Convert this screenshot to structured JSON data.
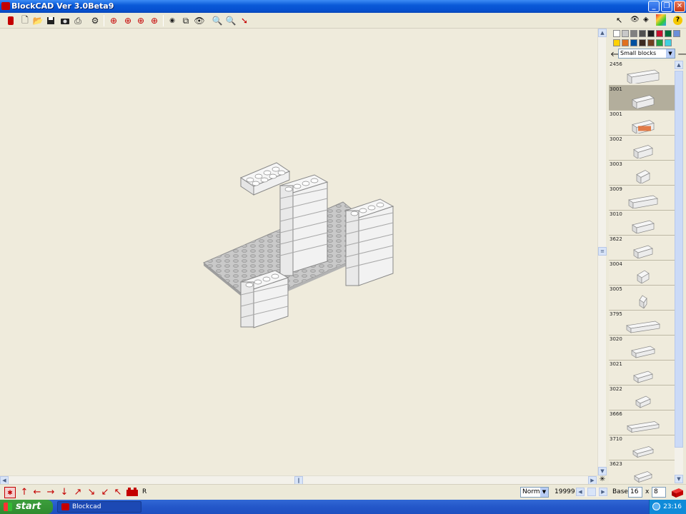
{
  "window": {
    "title": "BlockCAD Ver 3.0Beta9"
  },
  "toolbar": {
    "icons": [
      "brick-icon",
      "new-icon",
      "open-icon",
      "save-icon",
      "camera-icon",
      "print-icon",
      "settings-icon",
      "rotate-left-icon",
      "rotate-up-icon",
      "rotate-down-icon",
      "rotate-right-icon",
      "rotate-icon",
      "copy-view-icon",
      "view-icon",
      "zoom-in-icon",
      "zoom-out-icon",
      "pen-icon"
    ]
  },
  "palette": {
    "colors": [
      "#ffffff",
      "#c8c8c8",
      "#808080",
      "#505050",
      "#202020",
      "#c8102e",
      "#006f3c",
      "#6b8fd8",
      "#ffd100",
      "#e07020",
      "#0050a0",
      "#3c2a20",
      "#704020",
      "#20a040",
      "#40d0e0"
    ],
    "category_selected": "Small blocks"
  },
  "blocks": [
    {
      "id": "2456"
    },
    {
      "id": "3001"
    },
    {
      "id": "3001"
    },
    {
      "id": "3002"
    },
    {
      "id": "3003"
    },
    {
      "id": "3009"
    },
    {
      "id": "3010"
    },
    {
      "id": "3622"
    },
    {
      "id": "3004"
    },
    {
      "id": "3005"
    },
    {
      "id": "3795"
    },
    {
      "id": "3020"
    },
    {
      "id": "3021"
    },
    {
      "id": "3022"
    },
    {
      "id": "3666"
    },
    {
      "id": "3710"
    },
    {
      "id": "3623"
    }
  ],
  "bottom": {
    "r_label": "R",
    "mode_value": "Norma",
    "count": "19999",
    "base_label": "Base:",
    "base_x": "16",
    "x_label": "x",
    "base_y": "8"
  },
  "taskbar": {
    "start_label": "start",
    "task_label": "Blockcad",
    "clock": "23:16"
  }
}
